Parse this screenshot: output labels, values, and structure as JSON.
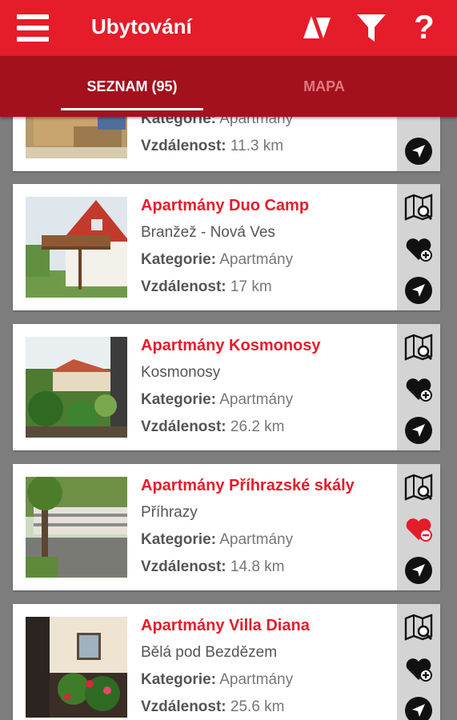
{
  "header": {
    "title": "Ubytování",
    "help_label": "?"
  },
  "tabs": {
    "list_label": "SEZNAM (95)",
    "map_label": "MAPA"
  },
  "labels": {
    "category": "Kategorie:",
    "distance": "Vzdálenost:"
  },
  "colors": {
    "brand_red": "#e51c2a",
    "tab_bar": "#a3111d",
    "favorite_active": "#e51c2a",
    "favorite_inactive": "#111111"
  },
  "items": [
    {
      "name": "",
      "location": "",
      "category": "Apartmány",
      "distance": "11.3 km",
      "favorite": false
    },
    {
      "name": "Apartmány Duo Camp",
      "location": "Branžež - Nová Ves",
      "category": "Apartmány",
      "distance": "17 km",
      "favorite": false
    },
    {
      "name": "Apartmány Kosmonosy",
      "location": "Kosmonosy",
      "category": "Apartmány",
      "distance": "26.2 km",
      "favorite": false
    },
    {
      "name": "Apartmány Příhrazské skály",
      "location": "Příhrazy",
      "category": "Apartmány",
      "distance": "14.8 km",
      "favorite": true
    },
    {
      "name": "Apartmány Villa Diana",
      "location": "Bělá pod Bezdězem",
      "category": "Apartmány",
      "distance": "25.6 km",
      "favorite": false
    }
  ]
}
